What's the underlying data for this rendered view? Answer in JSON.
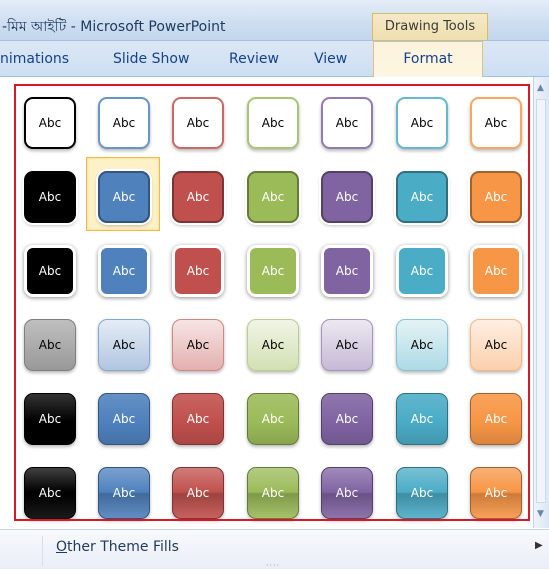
{
  "window": {
    "title": "-মিম আইটি - Microsoft PowerPoint",
    "context_tab": "Drawing Tools"
  },
  "ribbon": {
    "tabs": [
      {
        "label": "nimations"
      },
      {
        "label": "Slide Show"
      },
      {
        "label": "Review"
      },
      {
        "label": "View"
      },
      {
        "label": "Format",
        "active": true
      }
    ]
  },
  "gallery": {
    "swatch_text": "Abc",
    "theme_colors": [
      "#000000",
      "#4f81bd",
      "#c0504d",
      "#9bbb59",
      "#8064a2",
      "#4bacc6",
      "#f79646"
    ],
    "rows": [
      {
        "style": "colored-outline"
      },
      {
        "style": "colored-fill-white-outline"
      },
      {
        "style": "light-1-outline-colored-fill"
      },
      {
        "style": "subtle-effect"
      },
      {
        "style": "moderate-effect"
      },
      {
        "style": "intense-effect"
      }
    ],
    "hovered": {
      "row": 2,
      "col": 2
    }
  },
  "footer": {
    "prefix": "O",
    "label": "ther Theme Fills",
    "arrow_icon": "triangle-right"
  }
}
